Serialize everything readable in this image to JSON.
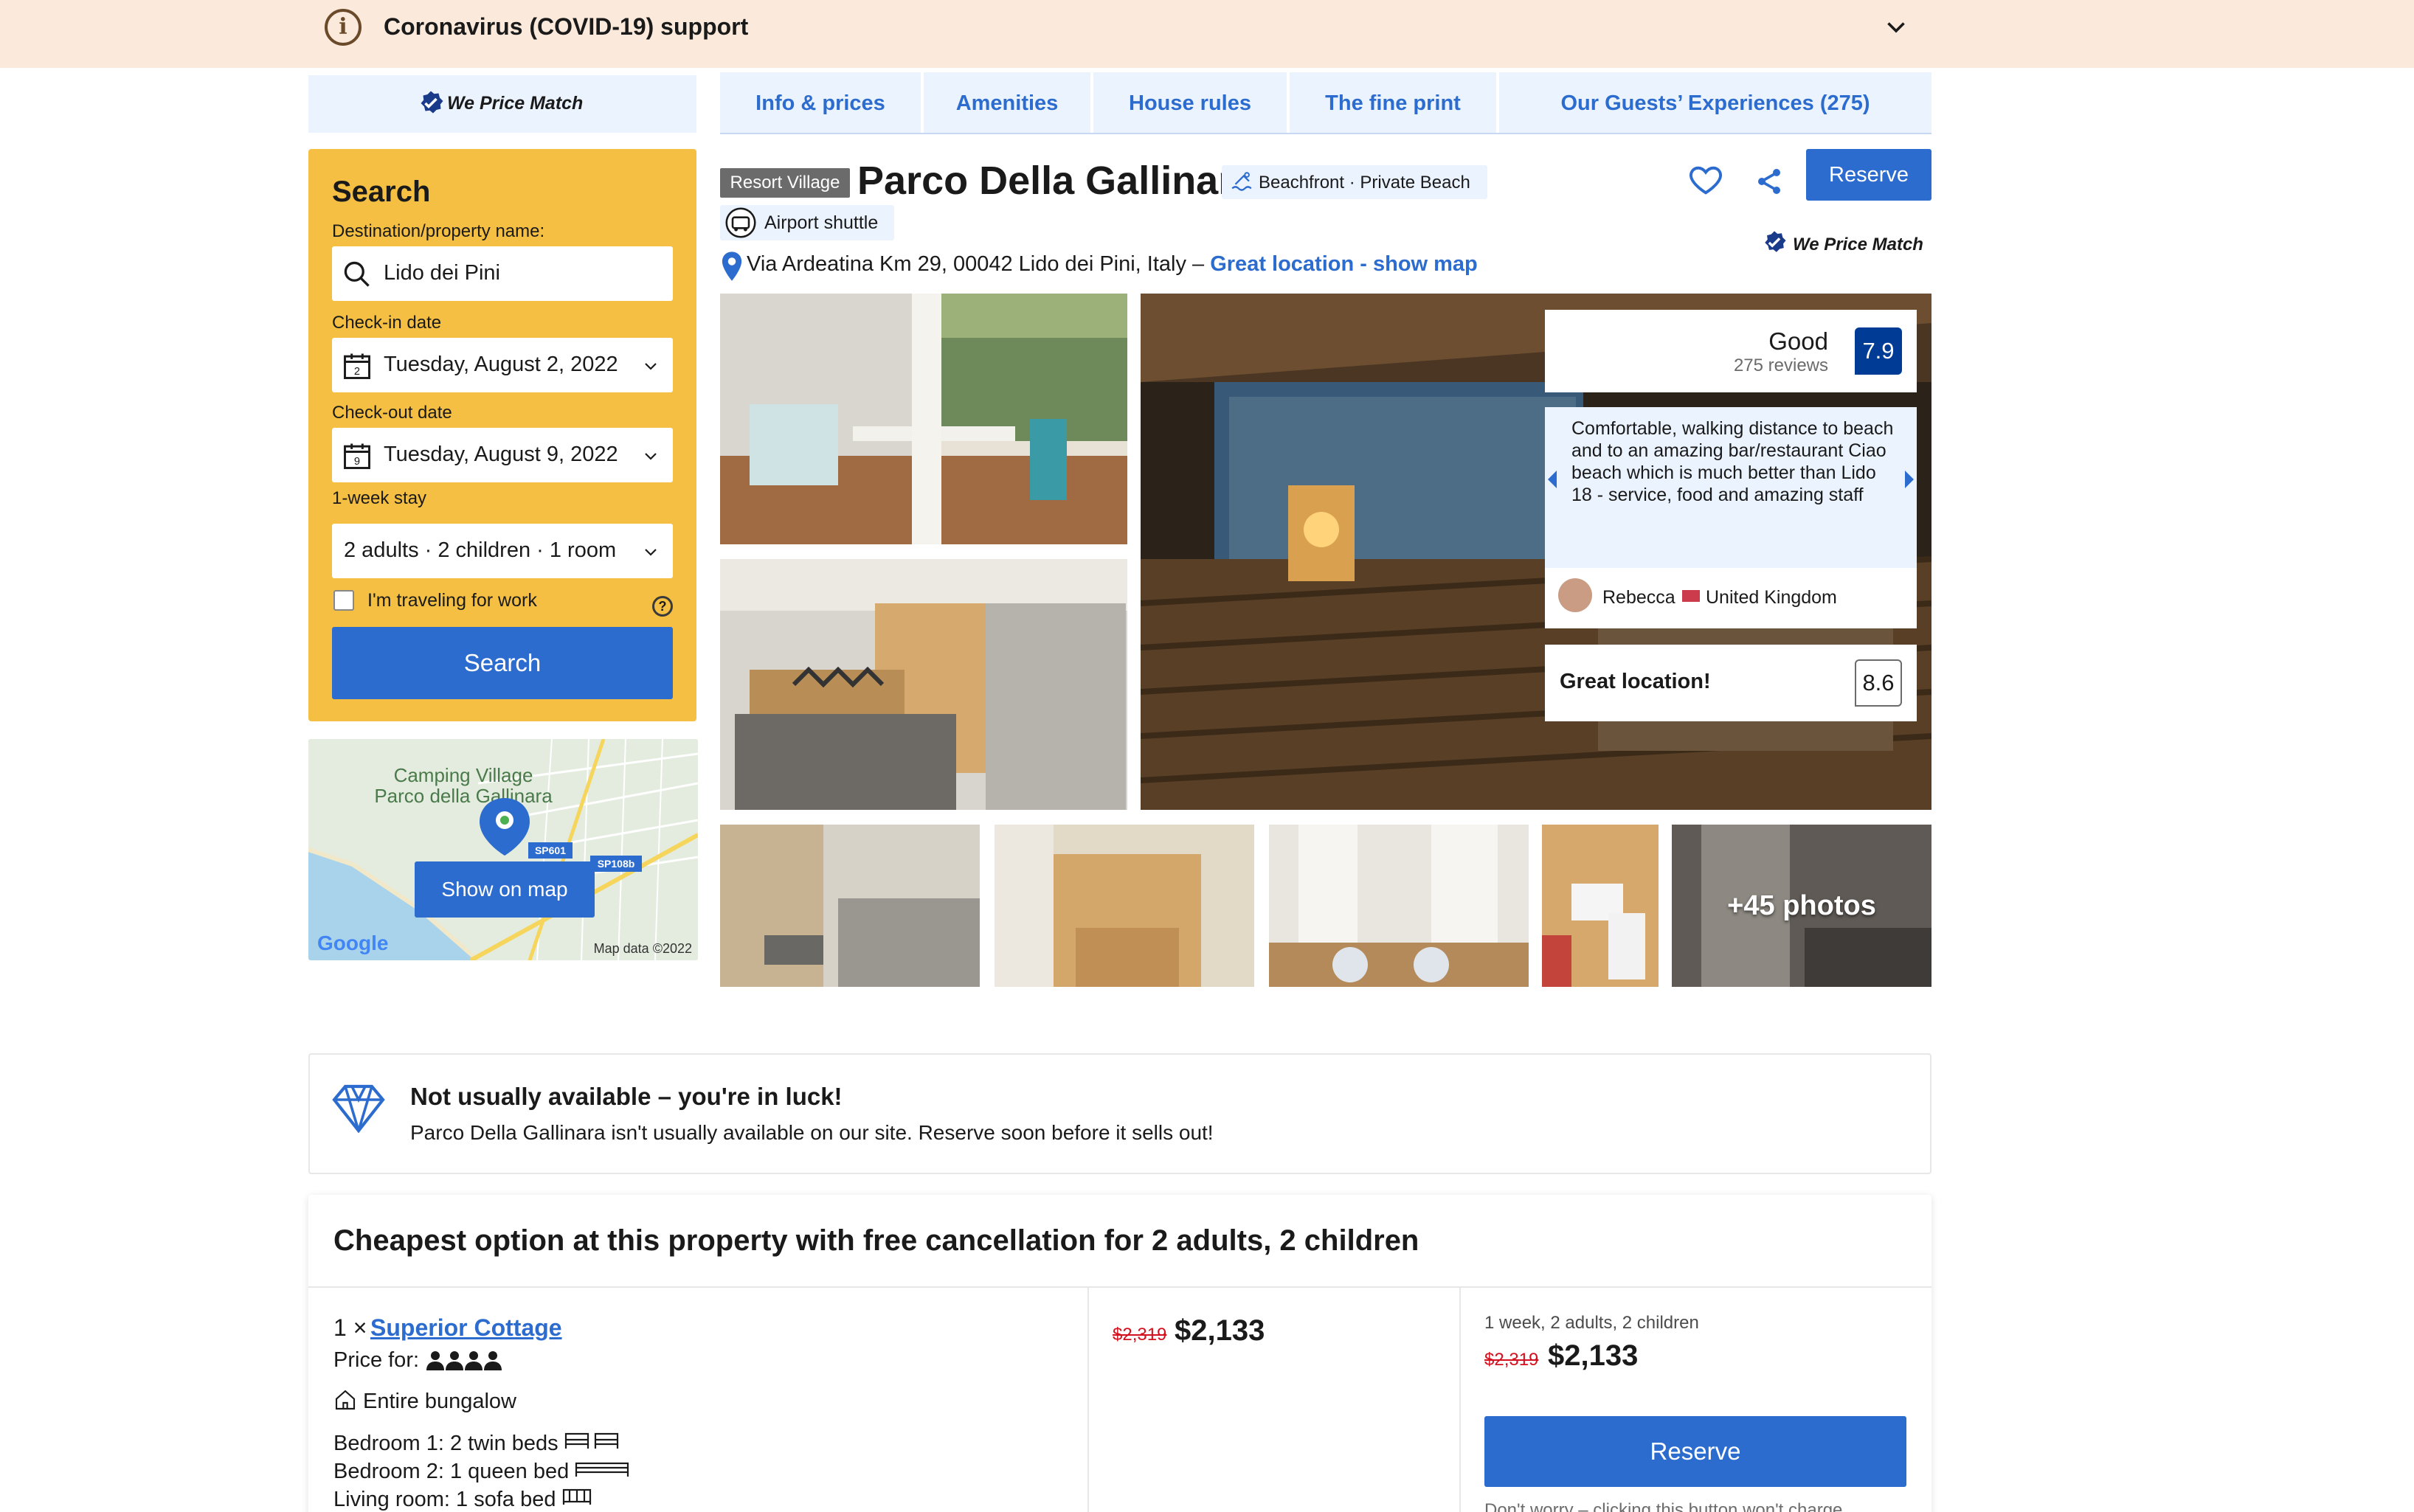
{
  "covid_banner": {
    "title": "Coronavirus (COVID-19) support"
  },
  "price_match": {
    "label": "We Price Match"
  },
  "search": {
    "title": "Search",
    "destination_label": "Destination/property name:",
    "destination_value": "Lido dei Pini",
    "checkin_label": "Check-in date",
    "checkin_value": "Tuesday, August 2, 2022",
    "checkin_day": "2",
    "checkout_label": "Check-out date",
    "checkout_value": "Tuesday, August 9, 2022",
    "checkout_day": "9",
    "stay_label": "1-week stay",
    "guests_value": "2 adults · 2 children · 1 room",
    "work_label": "I'm traveling for work",
    "help": "?",
    "button_label": "Search"
  },
  "map": {
    "place_label_1": "Camping Village",
    "place_label_2": "Parco della Gallinara",
    "road_1": "SP601",
    "road_2": "SP108b",
    "button_label": "Show on map",
    "google": "Google",
    "attribution": "Map data ©2022"
  },
  "tabs": [
    {
      "label": "Info & prices"
    },
    {
      "label": "Amenities"
    },
    {
      "label": "House rules"
    },
    {
      "label": "The fine print"
    },
    {
      "label": "Our Guests’ Experiences (275)"
    }
  ],
  "property": {
    "type_badge": "Resort Village",
    "name": "Parco Della Gallinara",
    "beach_badge": "Beachfront · Private Beach",
    "shuttle_badge": "Airport shuttle",
    "reserve_label": "Reserve",
    "address": "Via Ardeatina Km 29, 00042 Lido dei Pini, Italy – ",
    "location_link": "Great location - show map"
  },
  "photos": {
    "more_label": "+45 photos"
  },
  "review": {
    "score_word": "Good",
    "review_count": "275 reviews",
    "score": "7.9",
    "quote": "Comfortable, walking distance to beach and to an amazing bar/restaurant Ciao beach which is much better than Lido 18 - service, food and amazing staff",
    "author": "Rebecca",
    "country": "United Kingdom",
    "location_label": "Great location!",
    "location_score": "8.6"
  },
  "luck": {
    "title": "Not usually available – you're in luck!",
    "text": "Parco Della Gallinara isn't usually available on our site. Reserve soon before it sells out!"
  },
  "cheapest": {
    "title": "Cheapest option at this property with free cancellation for 2 adults, 2 children",
    "room_qty": "1 ×",
    "room_name": "Superior Cottage",
    "price_for_label": "Price for:",
    "entire_label": "Entire bungalow",
    "bedroom1_label": "Bedroom 1:",
    "bedroom1_value": "2 twin beds",
    "bedroom2_label": "Bedroom 2:",
    "bedroom2_value": "1 queen bed",
    "living_label": "Living room:",
    "living_value": "1 sofa bed",
    "old_price": "$2,319",
    "new_price": "$2,133",
    "stay_summary": "1 week, 2 adults, 2 children",
    "reserve_label": "Reserve",
    "dont_worry": "Don't worry – clicking this button won't charge"
  },
  "colors": {
    "brand_blue": "#2c6ccf",
    "dark_blue": "#003b95",
    "search_yellow": "#f4bf42",
    "banner_bg": "#fbeadb",
    "strike_red": "#d4111e"
  }
}
